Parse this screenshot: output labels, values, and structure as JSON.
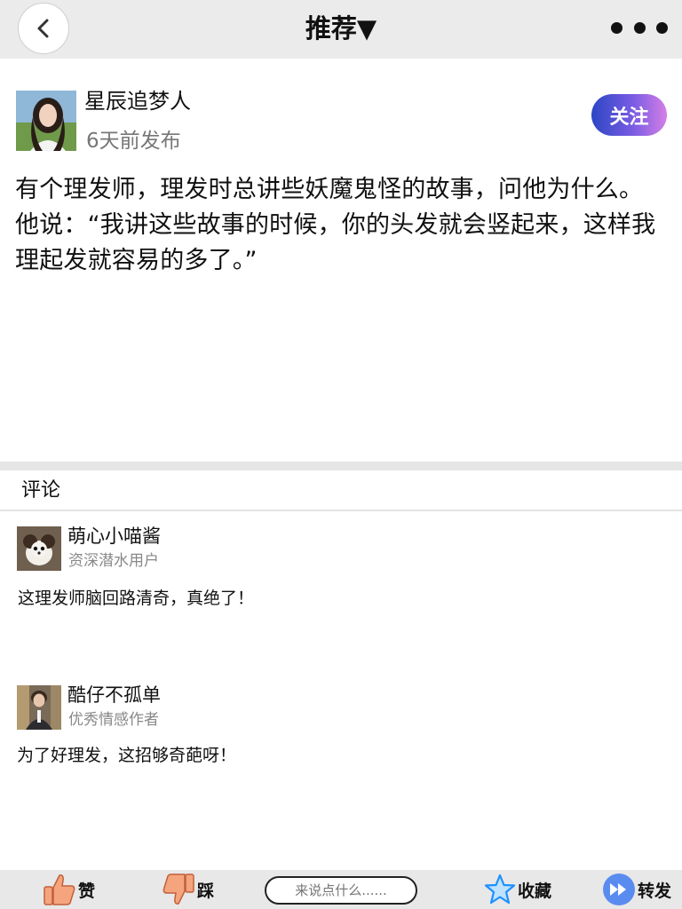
{
  "header": {
    "title": "推荐▼",
    "back_icon": "chevron-left-icon",
    "more_icon": "more-horizontal-icon"
  },
  "post": {
    "author": "星辰追梦人",
    "time": "6天前发布",
    "follow_label": "关注",
    "content": "有个理发师，理发时总讲些妖魔鬼怪的故事，问他为什么。 他说：“我讲这些故事的时候，你的头发就会竖起来，这样我理起发就容易的多了。”"
  },
  "comments": {
    "title": "评论",
    "items": [
      {
        "name": "萌心小喵酱",
        "tag": "资深潜水用户",
        "text": "这理发师脑回路清奇，真绝了！"
      },
      {
        "name": "酷仔不孤单",
        "tag": "优秀情感作者",
        "text": "为了好理发，这招够奇葩呀！"
      }
    ]
  },
  "bottom_bar": {
    "like_label": "赞",
    "dislike_label": "踩",
    "input_placeholder": "来说点什么......",
    "favorite_label": "收藏",
    "share_label": "转发"
  },
  "colors": {
    "follow_gradient_start": "#2b47c4",
    "follow_gradient_end": "#d47fe6",
    "like_icon": "#f5a57e",
    "star_icon": "#1e90ff",
    "share_icon": "#5a8cf0"
  }
}
